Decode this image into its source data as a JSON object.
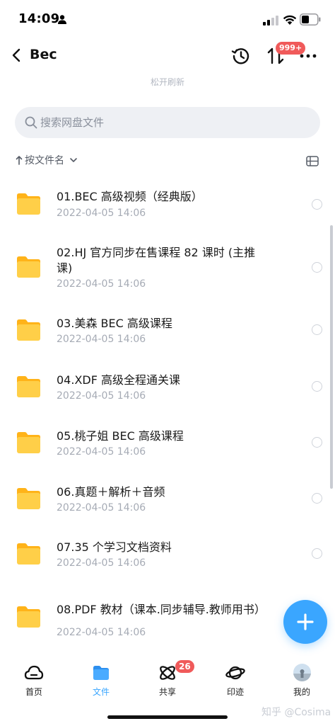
{
  "status_bar": {
    "time": "14:09"
  },
  "nav": {
    "title": "Bec",
    "sort_badge": "999+"
  },
  "pull_hint": "松开刷新",
  "search": {
    "placeholder": "搜索网盘文件",
    "value": ""
  },
  "sort": {
    "label": "按文件名"
  },
  "files": [
    {
      "name": "01.BEC 高级视频（经典版）",
      "date": "2022-04-05 14:06"
    },
    {
      "name": "02.HJ 官方同步在售课程 82 课时 (主推课)",
      "date": "2022-04-05 14:06"
    },
    {
      "name": "03.美森 BEC 高级课程",
      "date": "2022-04-05 14:06"
    },
    {
      "name": "04.XDF 高级全程通关课",
      "date": "2022-04-05 14:06"
    },
    {
      "name": "05.桃子姐 BEC 高级课程",
      "date": "2022-04-05 14:06"
    },
    {
      "name": "06.真题＋解析＋音频",
      "date": "2022-04-05 14:06"
    },
    {
      "name": "07.35 个学习文档资料",
      "date": "2022-04-05 14:06"
    },
    {
      "name": "08.PDF 教材（课本.同步辅导.教师用书）",
      "date": "2022-04-05 14:06"
    }
  ],
  "tabs": [
    {
      "label": "首页",
      "icon": "cloud-home-icon"
    },
    {
      "label": "文件",
      "icon": "folder-icon"
    },
    {
      "label": "共享",
      "icon": "share-orbit-icon",
      "badge": "26"
    },
    {
      "label": "印迹",
      "icon": "planet-icon"
    },
    {
      "label": "我的",
      "icon": "avatar"
    }
  ],
  "active_tab": "文件",
  "watermark": "知乎 @Cosima",
  "colors": {
    "accent": "#3aa6ff",
    "badge": "#f05a5a",
    "folder": "#ffc93a"
  }
}
